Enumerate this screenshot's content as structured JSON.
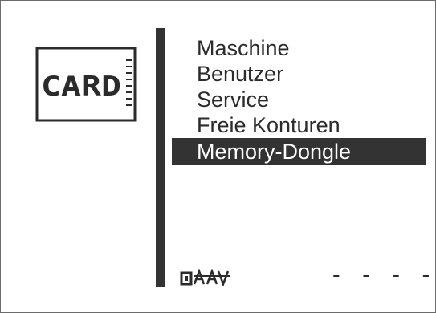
{
  "card_icon": {
    "label": "CARD",
    "icon": "memory-card-icon"
  },
  "menu": {
    "items": [
      {
        "label": "Maschine",
        "selected": false
      },
      {
        "label": "Benutzer",
        "selected": false
      },
      {
        "label": "Service",
        "selected": false
      },
      {
        "label": "Freie Konturen",
        "selected": false
      },
      {
        "label": "Memory-Dongle",
        "selected": true
      }
    ]
  },
  "status": {
    "icon": "key-code-icon",
    "value": "- - - -"
  },
  "colors": {
    "foreground": "#2b2b2b",
    "selection_bg": "#333333",
    "selection_fg": "#ffffff",
    "background": "#ffffff"
  }
}
